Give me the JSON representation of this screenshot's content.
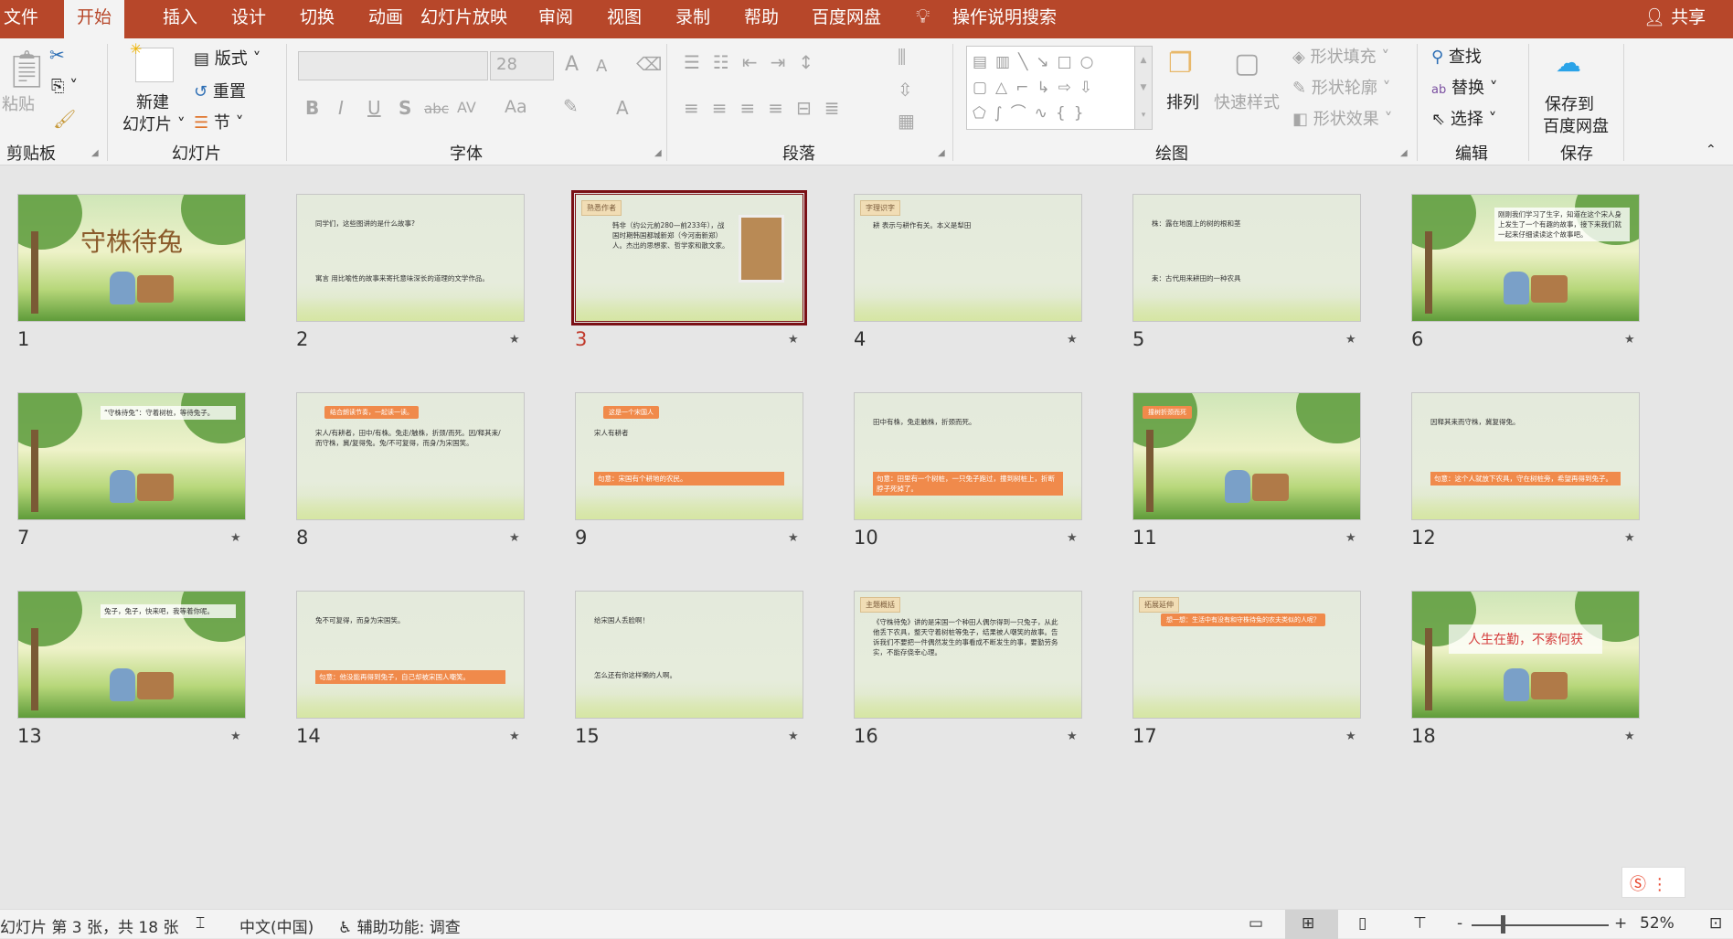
{
  "titlebar": {
    "tabs": [
      "文件",
      "开始",
      "插入",
      "设计",
      "切换",
      "动画",
      "幻灯片放映",
      "审阅",
      "视图",
      "录制",
      "帮助",
      "百度网盘"
    ],
    "active_tab": "开始",
    "search_label": "操作说明搜索",
    "share_label": "共享",
    "color": "#b7472a"
  },
  "ribbon": {
    "clipboard": {
      "paste": "粘贴",
      "group": "剪贴板"
    },
    "slides": {
      "new_slide_line1": "新建",
      "new_slide_line2": "幻灯片",
      "layout": "版式",
      "reset": "重置",
      "section": "节",
      "group": "幻灯片"
    },
    "font": {
      "font_name": "",
      "font_size": "28",
      "bold": "B",
      "italic": "I",
      "underline": "U",
      "shadow": "S",
      "strike": "abc",
      "spacing": "AV",
      "case": "Aa",
      "color": "A",
      "grow": "A",
      "shrink": "A",
      "group": "字体"
    },
    "paragraph": {
      "group": "段落"
    },
    "drawing": {
      "arrange": "排列",
      "quick_styles": "快速样式",
      "shape_fill": "形状填充",
      "shape_outline": "形状轮廓",
      "shape_effects": "形状效果",
      "group": "绘图"
    },
    "editing": {
      "find": "查找",
      "replace": "替换",
      "select": "选择",
      "group": "编辑"
    },
    "save": {
      "line1": "保存到",
      "line2": "百度网盘",
      "group": "保存"
    }
  },
  "slides": [
    {
      "n": "1",
      "scene": "forest",
      "title": "守株待兔"
    },
    {
      "n": "2",
      "scene": "plain",
      "text": "同学们，这些图讲的是什么故事?",
      "text2": "寓言 用比喻性的故事来寄托意味深长的道理的文学作品。"
    },
    {
      "n": "3",
      "scene": "plain",
      "tag": "熟悉作者",
      "text": "韩非（约公元前280—前233年），战国时期韩国都城新郑（今河南新郑）人。杰出的思想家、哲学家和散文家。",
      "selected": true
    },
    {
      "n": "4",
      "scene": "plain",
      "tag": "字理识字",
      "text": "耕 表示与耕作有关。本义是犁田"
    },
    {
      "n": "5",
      "scene": "plain",
      "text": "株：露在地面上的树的根和茎",
      "text2": "耒：古代用来耕田的一种农具"
    },
    {
      "n": "6",
      "scene": "forest",
      "text": "刚刚我们学习了生字，知道在这个宋人身上发生了一个有趣的故事，接下来我们就一起来仔细读读这个故事吧。"
    },
    {
      "n": "7",
      "scene": "forest",
      "text": "“守株待兔”：守着树桩，等待兔子。"
    },
    {
      "n": "8",
      "scene": "plain",
      "hl": "结合朗读节奏，一起读一读。",
      "text": "宋人/有耕者，田中/有株。兔走/触株，折颈/而死。因/释其耒/而守株，冀/复得兔。兔/不可复得，而身/为宋国笑。"
    },
    {
      "n": "9",
      "scene": "plain",
      "hl": "这是一个宋国人",
      "text": "宋人有耕者",
      "text2": "句意：宋国有个耕地的农民。"
    },
    {
      "n": "10",
      "scene": "plain",
      "text": "田中有株，兔走触株，折颈而死。",
      "text2": "句意：田里有一个树桩，一只兔子跑过，撞到树桩上，折断脖子死掉了。"
    },
    {
      "n": "11",
      "scene": "forest",
      "hl": "撞树折颈而死"
    },
    {
      "n": "12",
      "scene": "plain",
      "text": "因释其耒而守株，冀复得兔。",
      "text2": "句意：这个人就放下农具，守在树桩旁，希望再得到兔子。"
    },
    {
      "n": "13",
      "scene": "forest",
      "text": "兔子，兔子，快来吧，我等着你呢。"
    },
    {
      "n": "14",
      "scene": "plain",
      "text": "兔不可复得，而身为宋国笑。",
      "text2": "句意：他没能再得到兔子，自己却被宋国人嘲笑。"
    },
    {
      "n": "15",
      "scene": "plain",
      "text": "给宋国人丢脸啊！",
      "text2": "怎么还有你这样懒的人啊。"
    },
    {
      "n": "16",
      "scene": "plain",
      "tag": "主题概括",
      "text": "《守株待兔》讲的是宋国一个种田人偶尔得到一只兔子，从此他丢下农具，整天守着树桩等兔子，结果被人嘲笑的故事。告诉我们不要把一件偶然发生的事看成不断发生的事，要勤劳务实，不能存侥幸心理。"
    },
    {
      "n": "17",
      "scene": "plain",
      "tag": "拓展延伸",
      "hl": "想一想：生活中有没有和守株待兔的农夫类似的人呢？"
    },
    {
      "n": "18",
      "scene": "forest",
      "title": "人生在勤，不索何获"
    }
  ],
  "statusbar": {
    "slide_info": "幻灯片 第 3 张，共 18 张",
    "language": "中文(中国)",
    "accessibility": "辅助功能: 调查",
    "zoom": "52%",
    "zoom_minus": "-",
    "zoom_plus": "+"
  }
}
